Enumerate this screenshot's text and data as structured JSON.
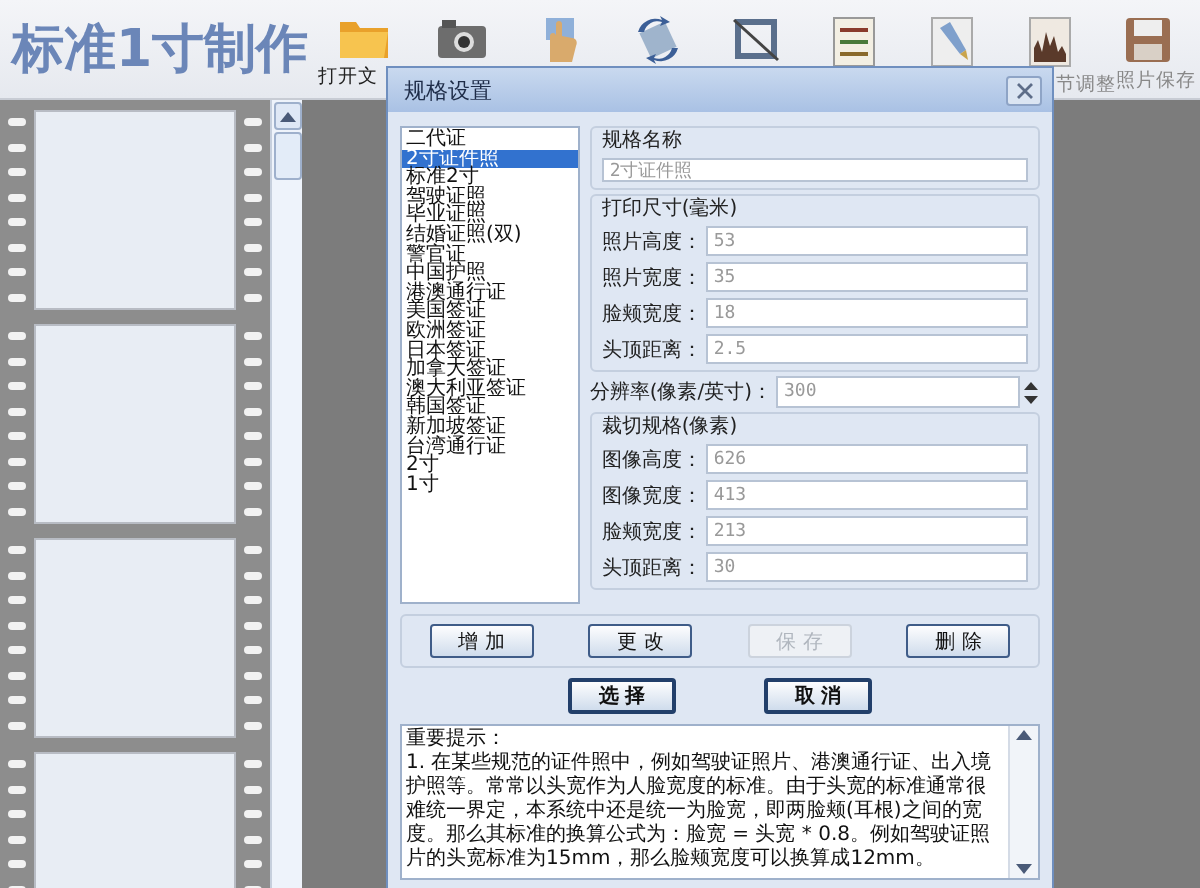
{
  "app_title": "标准1寸制作",
  "toolbar": [
    {
      "kind": "folder",
      "label": "打开文"
    },
    {
      "kind": "camera"
    },
    {
      "kind": "hand"
    },
    {
      "kind": "rotate"
    },
    {
      "kind": "crop"
    },
    {
      "kind": "sliders"
    },
    {
      "kind": "brush"
    },
    {
      "kind": "histogram",
      "label": "节调整"
    },
    {
      "kind": "floppy",
      "label": "照片保存"
    }
  ],
  "dialog": {
    "title": "规格设置",
    "spec_list": [
      {
        "label": "二代证",
        "selected": false
      },
      {
        "label": "2寸证件照",
        "selected": true
      },
      {
        "label": "标准2寸",
        "selected": false
      },
      {
        "label": "驾驶证照",
        "selected": false
      },
      {
        "label": "毕业证照",
        "selected": false
      },
      {
        "label": "结婚证照(双)",
        "selected": false
      },
      {
        "label": "警官证",
        "selected": false
      },
      {
        "label": "中国护照",
        "selected": false
      },
      {
        "label": "港澳通行证",
        "selected": false
      },
      {
        "label": "美国签证",
        "selected": false
      },
      {
        "label": "欧洲签证",
        "selected": false
      },
      {
        "label": "日本签证",
        "selected": false
      },
      {
        "label": "加拿大签证",
        "selected": false
      },
      {
        "label": "澳大利亚签证",
        "selected": false
      },
      {
        "label": "韩国签证",
        "selected": false
      },
      {
        "label": "新加坡签证",
        "selected": false
      },
      {
        "label": "台湾通行证",
        "selected": false
      },
      {
        "label": "2寸",
        "selected": false
      },
      {
        "label": "1寸",
        "selected": false
      }
    ],
    "spec_name": {
      "title": "规格名称",
      "value": "2寸证件照"
    },
    "print_size": {
      "title": "打印尺寸(毫米)",
      "fields": [
        {
          "label": "照片高度：",
          "value": "53"
        },
        {
          "label": "照片宽度：",
          "value": "35"
        },
        {
          "label": "脸颊宽度：",
          "value": "18"
        },
        {
          "label": "头顶距离：",
          "value": "2.5"
        }
      ]
    },
    "resolution": {
      "label": "分辨率(像素/英寸)：",
      "value": "300"
    },
    "crop_size": {
      "title": "裁切规格(像素)",
      "fields": [
        {
          "label": "图像高度：",
          "value": "626"
        },
        {
          "label": "图像宽度：",
          "value": "413"
        },
        {
          "label": "脸颊宽度：",
          "value": "213"
        },
        {
          "label": "头顶距离：",
          "value": "30"
        }
      ]
    },
    "edit_buttons": [
      {
        "label": "增 加",
        "disabled": false
      },
      {
        "label": "更 改",
        "disabled": false
      },
      {
        "label": "保 存",
        "disabled": true
      },
      {
        "label": "删 除",
        "disabled": false
      }
    ],
    "action_buttons": [
      {
        "label": "选  择"
      },
      {
        "label": "取  消"
      }
    ],
    "notes": {
      "heading": "重要提示：",
      "body": "1.  在某些规范的证件照中，例如驾驶证照片、港澳通行证、出入境护照等。常常以头宽作为人脸宽度的标准。由于头宽的标准通常很难统一界定，本系统中还是统一为脸宽，即两脸颊(耳根)之间的宽度。那么其标准的换算公式为：脸宽 = 头宽 * 0.8。例如驾驶证照片的头宽标准为15mm，那么脸颊宽度可以换算成12mm。"
    }
  }
}
